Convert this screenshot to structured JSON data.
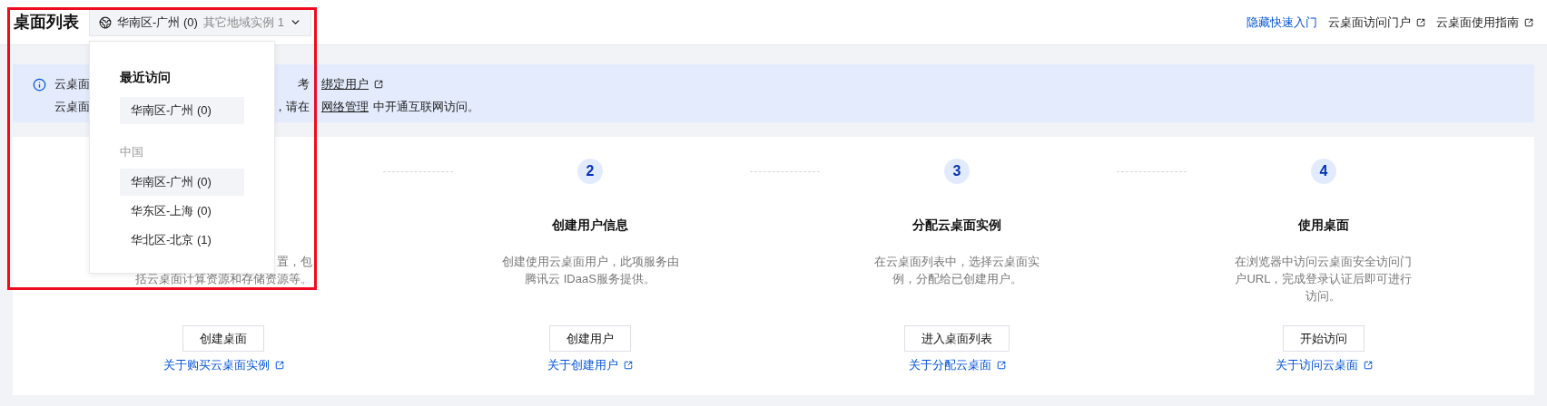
{
  "header": {
    "title": "桌面列表",
    "region_selector": {
      "current": "华南区-广州 (0)",
      "other": "其它地域实例 1"
    },
    "links": [
      {
        "label": "隐藏快速入门",
        "kind": "action"
      },
      {
        "label": "云桌面访问门户",
        "kind": "external"
      },
      {
        "label": "云桌面使用指南",
        "kind": "external"
      }
    ]
  },
  "banner": {
    "lines": [
      {
        "start": "云桌面",
        "before": "考",
        "link": "绑定用户",
        "external": true
      },
      {
        "start": "云桌面",
        "before": "，请在",
        "link": "网络管理",
        "after": "中开通互联网访问。",
        "external": false
      }
    ]
  },
  "steps": [
    {
      "kind": "partial",
      "description": [
        "置，包",
        "括云桌面计算资源和存储资源等。"
      ],
      "button": "创建桌面",
      "link": "关于购买云桌面实例"
    },
    {
      "kind": "full",
      "number": "2",
      "title": "创建用户信息",
      "description": [
        "创建使用云桌面用户，此项服务由",
        "腾讯云 IDaaS服务提供。"
      ],
      "button": "创建用户",
      "link": "关于创建用户"
    },
    {
      "kind": "full",
      "number": "3",
      "title": "分配云桌面实例",
      "description": [
        "在云桌面列表中，选择云桌面实",
        "例，分配给已创建用户。"
      ],
      "button": "进入桌面列表",
      "link": "关于分配云桌面"
    },
    {
      "kind": "full",
      "number": "4",
      "title": "使用桌面",
      "description": [
        "在浏览器中访问云桌面安全访问门",
        "户URL，完成登录认证后即可进行",
        "访问。"
      ],
      "button": "开始访问",
      "link": "关于访问云桌面"
    }
  ],
  "region_dropdown": {
    "sections": [
      {
        "title": "最近访问",
        "kind": "heading",
        "items": [
          {
            "label": "华南区-广州 (0)",
            "selected": true
          }
        ]
      },
      {
        "title": "中国",
        "kind": "group",
        "items": [
          {
            "label": "华南区-广州 (0)",
            "selected": true
          },
          {
            "label": "华东区-上海 (0)",
            "selected": false
          },
          {
            "label": "华北区-北京 (1)",
            "selected": false
          }
        ]
      }
    ]
  }
}
